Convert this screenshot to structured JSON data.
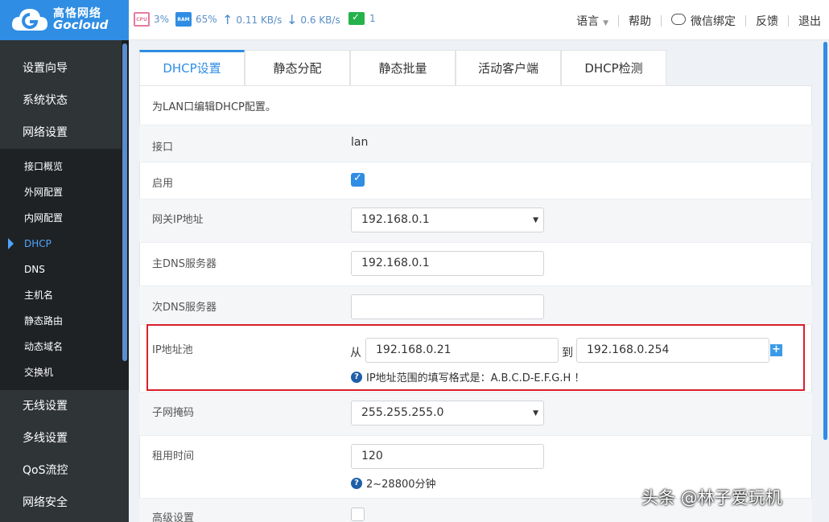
{
  "brand": {
    "name_cn": "高恪网络",
    "name_en": "Gocloud"
  },
  "status": {
    "cpu_label": "CPU",
    "cpu_value": "3%",
    "ram_label": "RAM",
    "ram_value": "65%",
    "upload": "0.11 KB/s",
    "download": "0.6 KB/s",
    "devices": "1"
  },
  "top_menu": {
    "language": "语言",
    "help": "帮助",
    "wechat": "微信绑定",
    "feedback": "反馈",
    "logout": "退出"
  },
  "sidebar": {
    "top_items": [
      "设置向导",
      "系统状态",
      "网络设置"
    ],
    "sub_items": [
      "接口概览",
      "外网配置",
      "内网配置",
      "DHCP",
      "DNS",
      "主机名",
      "静态路由",
      "动态域名",
      "交换机"
    ],
    "active_sub": "DHCP",
    "bottom_items": [
      "无线设置",
      "多线设置",
      "QoS流控",
      "网络安全"
    ]
  },
  "tabs": [
    "DHCP设置",
    "静态分配",
    "静态批量",
    "活动客户端",
    "DHCP检测"
  ],
  "description": "为LAN口编辑DHCP配置。",
  "form": {
    "interface_label": "接口",
    "interface_value": "lan",
    "enable_label": "启用",
    "gateway_label": "网关IP地址",
    "gateway_value": "192.168.0.1",
    "dns1_label": "主DNS服务器",
    "dns1_value": "192.168.0.1",
    "dns2_label": "次DNS服务器",
    "dns2_value": "",
    "pool_label": "IP地址池",
    "pool_from_label": "从",
    "pool_from": "192.168.0.21",
    "pool_to_label": "到",
    "pool_to": "192.168.0.254",
    "pool_hint": "IP地址范围的填写格式是：A.B.C.D-E.F.G.H ！",
    "mask_label": "子网掩码",
    "mask_value": "255.255.255.0",
    "lease_label": "租用时间",
    "lease_value": "120",
    "lease_hint": "2~28800分钟",
    "advanced_label": "高级设置"
  },
  "watermark": "头条 @林子爱玩机",
  "colors": {
    "brand": "#2f8de4",
    "sidebar_bg": "#2f3437",
    "highlight": "#d9202a"
  }
}
